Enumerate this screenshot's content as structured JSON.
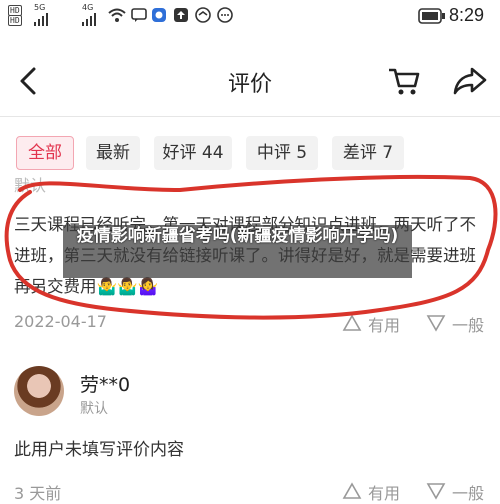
{
  "status_bar": {
    "badge1": "HD",
    "badge2": "HD",
    "net1": "5G",
    "net2": "4G",
    "time": "8:29"
  },
  "header": {
    "title": "评价"
  },
  "tabs": [
    {
      "label": "全部",
      "active": true
    },
    {
      "label": "最新",
      "active": false
    },
    {
      "label": "好评 44",
      "active": false
    },
    {
      "label": "中评 5",
      "active": false
    },
    {
      "label": "差评 7",
      "active": false
    }
  ],
  "review1": {
    "prev_label": "默认",
    "text": "三天课程已经听完，第一天对课程部分知识点进班，两天听了不进班，第三天就没有给链接听课了。讲得好是好，就是需要进班再另交费用🤷‍♂️🤷‍♂️🤷‍♀️",
    "date": "2022-04-17",
    "helpful_label": "有用",
    "normal_label": "一般"
  },
  "review2": {
    "user": "劳**0",
    "label": "默认",
    "text": "此用户未填写评价内容",
    "date": "3 天前",
    "helpful_label": "有用",
    "normal_label": "一般"
  },
  "overlay": {
    "text": "疫情影响新疆省考吗(新疆疫情影响开学吗)"
  },
  "colors": {
    "accent": "#e2334d",
    "annotation": "#d9342b"
  }
}
